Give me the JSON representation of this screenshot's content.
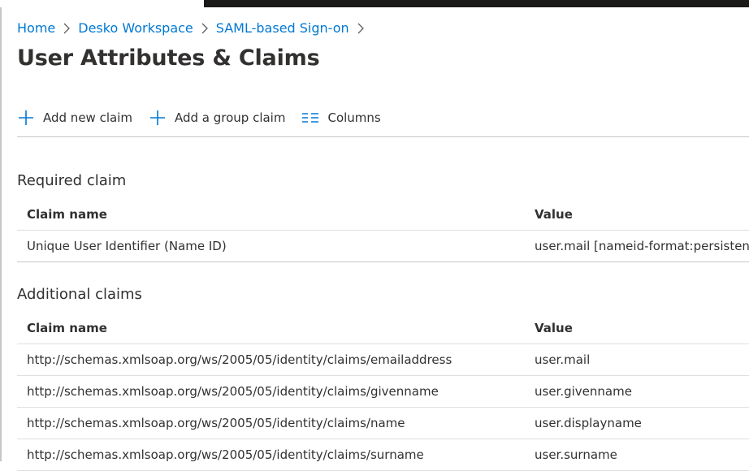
{
  "breadcrumb": [
    {
      "label": "Home"
    },
    {
      "label": "Desko Workspace"
    },
    {
      "label": "SAML-based Sign-on"
    }
  ],
  "page": {
    "title": "User Attributes & Claims"
  },
  "toolbar": {
    "add_new_claim": "Add new claim",
    "add_group_claim": "Add a group claim",
    "columns": "Columns"
  },
  "required": {
    "title": "Required claim",
    "headers": {
      "claim_name": "Claim name",
      "value": "Value"
    },
    "rows": [
      {
        "claim_name": "Unique User Identifier (Name ID)",
        "value": "user.mail [nameid-format:persistent]"
      }
    ]
  },
  "additional": {
    "title": "Additional claims",
    "headers": {
      "claim_name": "Claim name",
      "value": "Value"
    },
    "rows": [
      {
        "claim_name": "http://schemas.xmlsoap.org/ws/2005/05/identity/claims/emailaddress",
        "value": "user.mail"
      },
      {
        "claim_name": "http://schemas.xmlsoap.org/ws/2005/05/identity/claims/givenname",
        "value": "user.givenname"
      },
      {
        "claim_name": "http://schemas.xmlsoap.org/ws/2005/05/identity/claims/name",
        "value": "user.displayname"
      },
      {
        "claim_name": "http://schemas.xmlsoap.org/ws/2005/05/identity/claims/surname",
        "value": "user.surname"
      }
    ]
  },
  "colors": {
    "link": "#0078d4",
    "text": "#323130",
    "divider": "#e1dfdd"
  },
  "icons": {
    "add": "plus-icon",
    "columns": "columns-icon",
    "separator": "chevron-right-icon"
  }
}
